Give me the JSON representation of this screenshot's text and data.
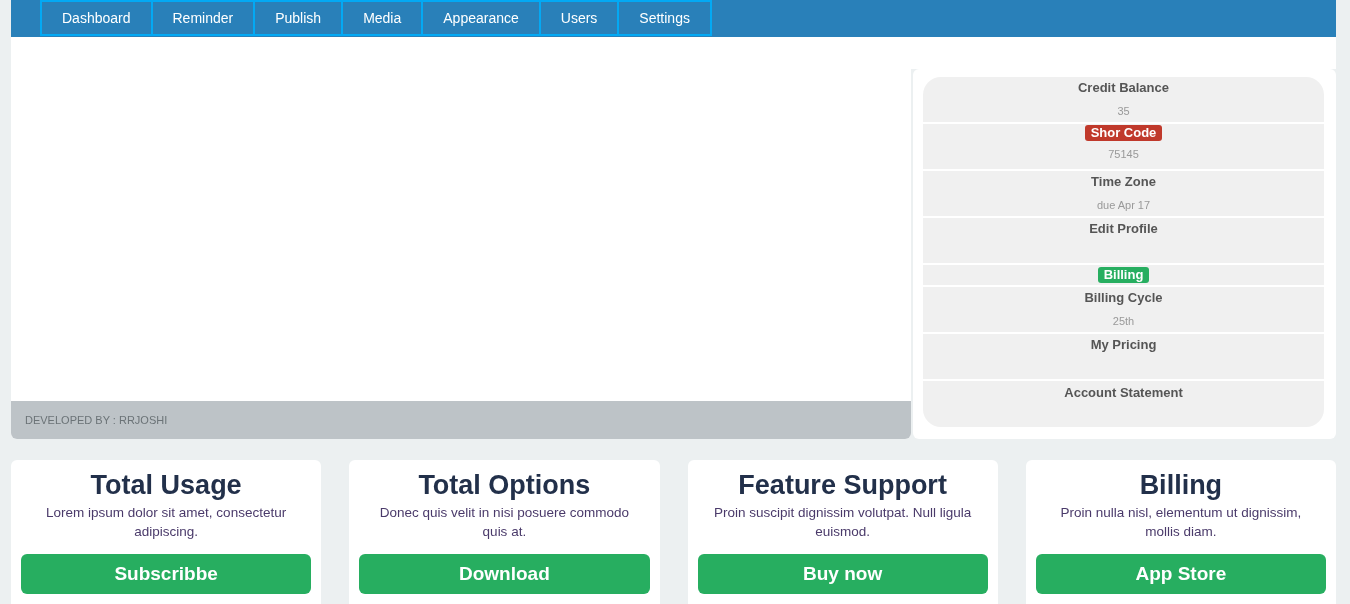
{
  "nav": {
    "tabs": [
      "Dashboard",
      "Reminder",
      "Publish",
      "Media",
      "Appearance",
      "Users",
      "Settings"
    ]
  },
  "footer": {
    "text": "DEVELOPED BY : RRJOSHI"
  },
  "account_list": [
    {
      "kind": "stat",
      "title": "Credit Balance",
      "value": "35"
    },
    {
      "kind": "badge",
      "badge": "Shor Code",
      "color": "#c0392b",
      "value": "75145"
    },
    {
      "kind": "stat",
      "title": "Time Zone",
      "value": "due Apr 17"
    },
    {
      "kind": "stat",
      "title": "Edit Profile"
    },
    {
      "kind": "badge",
      "badge": "Billing",
      "color": "#27ae60"
    },
    {
      "kind": "stat",
      "title": "Billing Cycle",
      "value": "25th"
    },
    {
      "kind": "stat",
      "title": "My Pricing"
    },
    {
      "kind": "stat",
      "title": "Account Statement"
    }
  ],
  "cards": [
    {
      "title": "Total Usage",
      "text": "Lorem ipsum dolor sit amet, consectetur adipiscing.",
      "button": "Subscribbe"
    },
    {
      "title": "Total Options",
      "text": "Donec quis velit in nisi posuere commodo quis at.",
      "button": "Download"
    },
    {
      "title": "Feature Support",
      "text": "Proin suscipit dignissim volutpat. Null ligula euismod.",
      "button": "Buy now"
    },
    {
      "title": "Billing",
      "text": "Proin nulla nisl, elementum ut dignissim, mollis diam.",
      "button": "App Store"
    }
  ]
}
